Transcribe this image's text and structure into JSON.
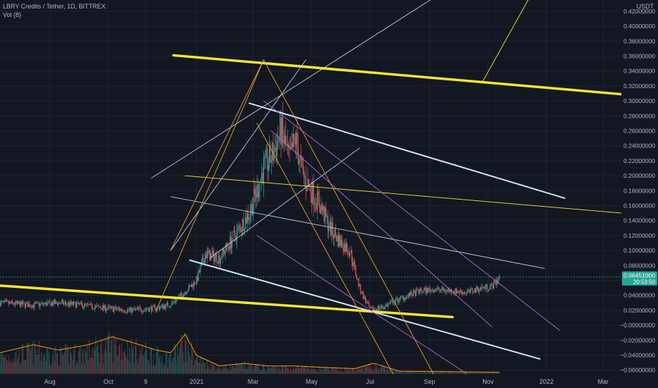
{
  "legend": {
    "symbol_line": "LBRY Credits / Tether, 1D, BITTREX",
    "volume_line": "Vol (8)"
  },
  "price_badge": {
    "price": "0.06451000",
    "countdown": "20:53:50"
  },
  "colors": {
    "background": "#131722",
    "grid": "#1f2330",
    "axis_text": "#b2b5be",
    "candle_up": "#26a69a",
    "candle_down": "#ef5350",
    "trendline_yellow": "#f7e531",
    "trendline_white": "#cfe4f2",
    "trendline_orange": "#e8a13a",
    "trendline_purple": "#b36bd6",
    "last_price": "#26a69a",
    "volume_ma": "#ff9800"
  },
  "chart_data": {
    "type": "candlestick",
    "currency_label": "USDT",
    "y_ticks": [
      "0.42000000",
      "0.40000000",
      "0.38000000",
      "0.36000000",
      "0.34000000",
      "0.32000000",
      "0.30000000",
      "0.28000000",
      "0.26000000",
      "0.24000000",
      "0.22000000",
      "0.20000000",
      "0.18000000",
      "0.16000000",
      "0.14000000",
      "0.12000000",
      "0.10000000",
      "0.08000000",
      "0.06000000",
      "0.04000000",
      "0.02000000",
      "−0.00000000",
      "−0.02000000",
      "−0.04000000",
      "−0.06000000"
    ],
    "y_tick_values": [
      0.42,
      0.4,
      0.38,
      0.36,
      0.34,
      0.32,
      0.3,
      0.28,
      0.26,
      0.24,
      0.22,
      0.2,
      0.18,
      0.16,
      0.14,
      0.12,
      0.1,
      0.08,
      0.06,
      0.04,
      0.02,
      0.0,
      -0.02,
      -0.04,
      -0.06
    ],
    "ylim": [
      -0.065,
      0.435
    ],
    "x_ticks": [
      {
        "label": "Aug",
        "date": "2020-08-01"
      },
      {
        "label": "Oct",
        "date": "2020-10-01"
      },
      {
        "label": "9",
        "date": "2020-11-09"
      },
      {
        "label": "2021",
        "date": "2021-01-01"
      },
      {
        "label": "Mar",
        "date": "2021-03-01"
      },
      {
        "label": "May",
        "date": "2021-05-01"
      },
      {
        "label": "Jul",
        "date": "2021-07-01"
      },
      {
        "label": "Sep",
        "date": "2021-09-01"
      },
      {
        "label": "Nov",
        "date": "2021-11-01"
      },
      {
        "label": "2022",
        "date": "2022-01-01"
      },
      {
        "label": "Mar",
        "date": "2022-03-01"
      }
    ],
    "xlim": [
      "2020-06-10",
      "2022-03-20"
    ],
    "price_path": [
      {
        "date": "2020-06-10",
        "close": 0.03
      },
      {
        "date": "2020-07-15",
        "close": 0.027
      },
      {
        "date": "2020-08-10",
        "close": 0.03
      },
      {
        "date": "2020-09-10",
        "close": 0.026
      },
      {
        "date": "2020-10-05",
        "close": 0.022
      },
      {
        "date": "2020-10-25",
        "close": 0.02
      },
      {
        "date": "2020-11-20",
        "close": 0.023
      },
      {
        "date": "2020-12-05",
        "close": 0.028
      },
      {
        "date": "2020-12-20",
        "close": 0.045
      },
      {
        "date": "2021-01-01",
        "close": 0.06
      },
      {
        "date": "2021-01-10",
        "close": 0.095
      },
      {
        "date": "2021-01-25",
        "close": 0.09
      },
      {
        "date": "2021-02-10",
        "close": 0.12
      },
      {
        "date": "2021-02-25",
        "close": 0.15
      },
      {
        "date": "2021-03-05",
        "close": 0.18
      },
      {
        "date": "2021-03-12",
        "close": 0.21
      },
      {
        "date": "2021-03-22",
        "close": 0.23
      },
      {
        "date": "2021-03-30",
        "close": 0.26
      },
      {
        "date": "2021-04-08",
        "close": 0.22
      },
      {
        "date": "2021-04-14",
        "close": 0.25
      },
      {
        "date": "2021-04-22",
        "close": 0.2
      },
      {
        "date": "2021-05-01",
        "close": 0.18
      },
      {
        "date": "2021-05-10",
        "close": 0.16
      },
      {
        "date": "2021-05-20",
        "close": 0.13
      },
      {
        "date": "2021-06-01",
        "close": 0.11
      },
      {
        "date": "2021-06-10",
        "close": 0.1
      },
      {
        "date": "2021-06-20",
        "close": 0.05
      },
      {
        "date": "2021-07-01",
        "close": 0.02
      },
      {
        "date": "2021-07-15",
        "close": 0.025
      },
      {
        "date": "2021-08-01",
        "close": 0.035
      },
      {
        "date": "2021-08-20",
        "close": 0.045
      },
      {
        "date": "2021-09-05",
        "close": 0.048
      },
      {
        "date": "2021-09-25",
        "close": 0.046
      },
      {
        "date": "2021-10-10",
        "close": 0.044
      },
      {
        "date": "2021-10-25",
        "close": 0.05
      },
      {
        "date": "2021-11-05",
        "close": 0.052
      },
      {
        "date": "2021-11-13",
        "close": 0.0645
      }
    ],
    "volume_envelope": [
      {
        "date": "2020-06-10",
        "v": 0.4
      },
      {
        "date": "2020-07-15",
        "v": 0.55
      },
      {
        "date": "2020-08-10",
        "v": 0.45
      },
      {
        "date": "2020-09-10",
        "v": 0.55
      },
      {
        "date": "2020-10-05",
        "v": 0.7
      },
      {
        "date": "2020-10-25",
        "v": 0.6
      },
      {
        "date": "2020-11-20",
        "v": 0.45
      },
      {
        "date": "2020-12-05",
        "v": 0.4
      },
      {
        "date": "2020-12-20",
        "v": 0.75
      },
      {
        "date": "2021-01-01",
        "v": 0.35
      },
      {
        "date": "2021-01-25",
        "v": 0.15
      },
      {
        "date": "2021-02-20",
        "v": 0.2
      },
      {
        "date": "2021-03-15",
        "v": 0.15
      },
      {
        "date": "2021-04-15",
        "v": 0.15
      },
      {
        "date": "2021-05-15",
        "v": 0.12
      },
      {
        "date": "2021-06-15",
        "v": 0.1
      },
      {
        "date": "2021-07-05",
        "v": 0.2
      },
      {
        "date": "2021-08-01",
        "v": 0.05
      },
      {
        "date": "2021-10-01",
        "v": 0.04
      },
      {
        "date": "2021-11-13",
        "v": 0.03
      }
    ],
    "last_price": 0.06451,
    "trendlines": [
      {
        "style": "yellow-thick",
        "from": {
          "date": "2020-12-08",
          "price": 0.361
        },
        "to": {
          "date": "2022-03-20",
          "price": 0.309
        }
      },
      {
        "style": "yellow-thick",
        "from": {
          "date": "2020-06-10",
          "price": 0.053
        },
        "to": {
          "date": "2021-09-25",
          "price": 0.011
        }
      },
      {
        "style": "yellow-thin",
        "from": {
          "date": "2021-10-26",
          "price": 0.325
        },
        "to": {
          "date": "2021-12-15",
          "price": 0.44
        }
      },
      {
        "style": "yellow-thin",
        "from": {
          "date": "2020-12-20",
          "price": 0.2
        },
        "to": {
          "date": "2022-03-20",
          "price": 0.15
        }
      },
      {
        "style": "white",
        "from": {
          "date": "2021-02-25",
          "price": 0.297
        },
        "to": {
          "date": "2022-01-20",
          "price": 0.17
        }
      },
      {
        "style": "white",
        "from": {
          "date": "2020-12-25",
          "price": 0.087
        },
        "to": {
          "date": "2021-12-25",
          "price": -0.045
        }
      },
      {
        "style": "white-thin",
        "from": {
          "date": "2020-12-05",
          "price": 0.172
        },
        "to": {
          "date": "2021-12-30",
          "price": 0.076
        }
      },
      {
        "style": "white-thin",
        "from": {
          "date": "2020-11-15",
          "price": 0.197
        },
        "to": {
          "date": "2021-09-20",
          "price": 0.45
        }
      },
      {
        "style": "white-thin",
        "from": {
          "date": "2020-12-05",
          "price": 0.1
        },
        "to": {
          "date": "2021-04-25",
          "price": 0.355
        }
      },
      {
        "style": "white-thin",
        "from": {
          "date": "2021-01-15",
          "price": 0.09
        },
        "to": {
          "date": "2021-06-20",
          "price": 0.237
        }
      },
      {
        "style": "orange-thin",
        "from": {
          "date": "2020-11-20",
          "price": 0.02
        },
        "to": {
          "date": "2021-03-12",
          "price": 0.355
        }
      },
      {
        "style": "orange-thin",
        "from": {
          "date": "2020-12-05",
          "price": 0.1
        },
        "to": {
          "date": "2021-03-12",
          "price": 0.355
        }
      },
      {
        "style": "orange-thin",
        "from": {
          "date": "2021-03-12",
          "price": 0.355
        },
        "to": {
          "date": "2021-09-05",
          "price": -0.065
        }
      },
      {
        "style": "orange-thin",
        "from": {
          "date": "2021-03-05",
          "price": 0.27
        },
        "to": {
          "date": "2021-07-25",
          "price": -0.065
        }
      },
      {
        "style": "purple-thin",
        "from": {
          "date": "2021-03-12",
          "price": 0.3
        },
        "to": {
          "date": "2022-01-15",
          "price": -0.007
        }
      },
      {
        "style": "purple-thin",
        "from": {
          "date": "2021-03-20",
          "price": 0.26
        },
        "to": {
          "date": "2021-11-05",
          "price": -0.002
        }
      },
      {
        "style": "purple-thin",
        "from": {
          "date": "2021-03-05",
          "price": 0.12
        },
        "to": {
          "date": "2021-10-10",
          "price": -0.065
        }
      }
    ]
  }
}
